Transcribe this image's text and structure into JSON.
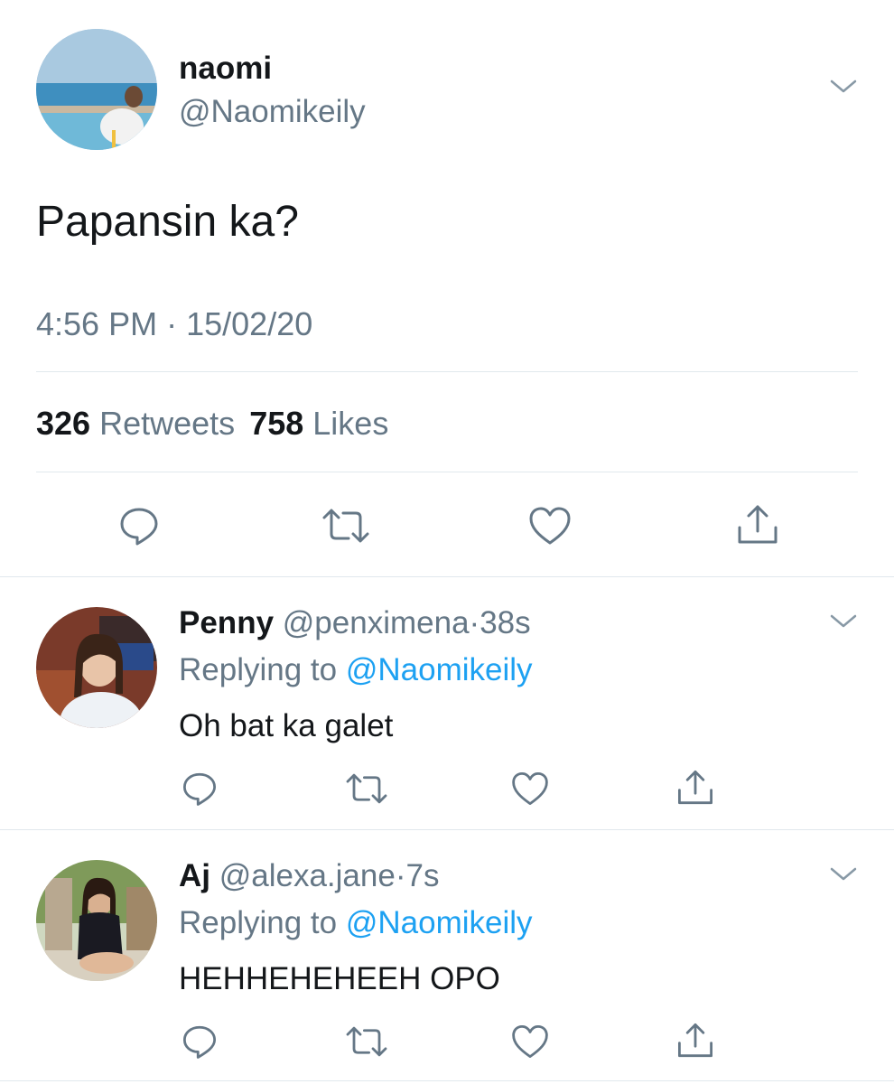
{
  "tweet": {
    "display_name": "naomi",
    "handle": "@Naomikeily",
    "text": "Papansin ka?",
    "time": "4:56 PM",
    "date": "15/02/20",
    "separator": "·",
    "retweets_count": "326",
    "retweets_label": "Retweets",
    "likes_count": "758",
    "likes_label": "Likes"
  },
  "replies": [
    {
      "display_name": "Penny",
      "handle": "@penximena",
      "age": "38s",
      "replying_label": "Replying to",
      "replying_to": "@Naomikeily",
      "text": "Oh bat ka galet"
    },
    {
      "display_name": "Aj",
      "handle": "@alexa.jane",
      "age": "7s",
      "replying_label": "Replying to",
      "replying_to": "@Naomikeily",
      "text": "HEHHEHEHEEH OPO"
    }
  ],
  "colors": {
    "text": "#14171a",
    "secondary": "#657786",
    "accent": "#1da1f2",
    "divider": "#e1e8ed"
  }
}
